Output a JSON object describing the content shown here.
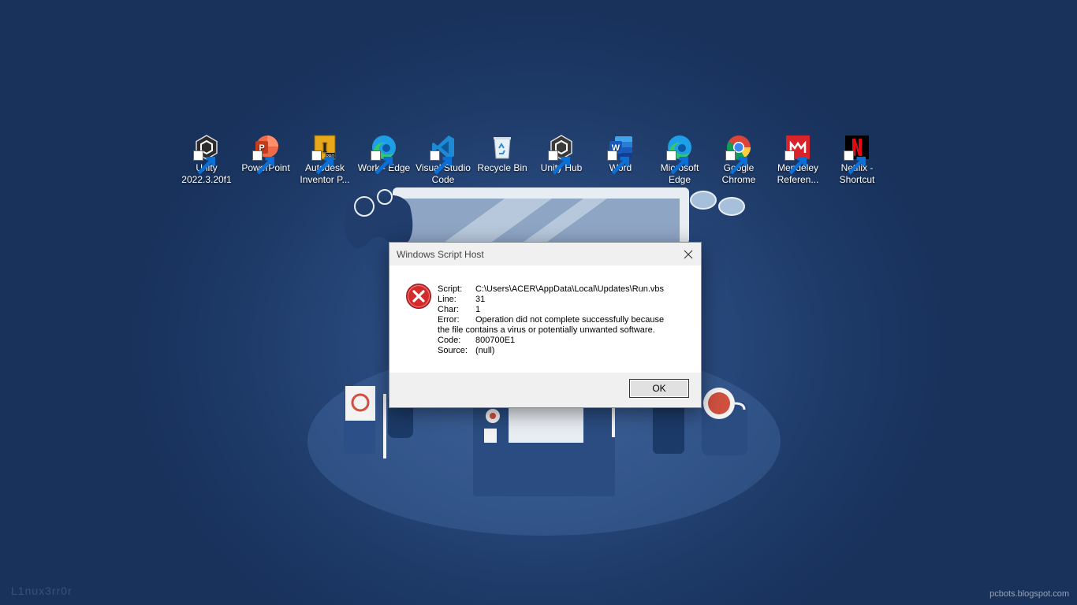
{
  "desktop": {
    "icons": [
      {
        "label": "Unity 2022.3.20f1",
        "icon": "unity-icon"
      },
      {
        "label": "PowerPoint",
        "icon": "powerpoint-icon"
      },
      {
        "label": "Autodesk Inventor P...",
        "icon": "autodesk-inventor-icon"
      },
      {
        "label": "Work - Edge",
        "icon": "edge-icon"
      },
      {
        "label": "Visual Studio Code",
        "icon": "vscode-icon"
      },
      {
        "label": "Recycle Bin",
        "icon": "recycle-bin-icon"
      },
      {
        "label": "Unity Hub",
        "icon": "unity-hub-icon"
      },
      {
        "label": "Word",
        "icon": "word-icon"
      },
      {
        "label": "Microsoft Edge",
        "icon": "edge-icon"
      },
      {
        "label": "Google Chrome",
        "icon": "chrome-icon"
      },
      {
        "label": "Mendeley Referen...",
        "icon": "mendeley-icon"
      },
      {
        "label": "Netflix - Shortcut",
        "icon": "netflix-icon"
      }
    ],
    "watermark_left": "L1nux3rr0r",
    "watermark_right": "pcbots.blogspot.com"
  },
  "dialog": {
    "title": "Windows Script Host",
    "fields": [
      {
        "key": "Script:",
        "value": "C:\\Users\\ACER\\AppData\\Local\\Updates\\Run.vbs"
      },
      {
        "key": "Line:",
        "value": "31"
      },
      {
        "key": "Char:",
        "value": "1"
      },
      {
        "key": "Error:",
        "value": "Operation did not complete successfully because"
      },
      {
        "key": "",
        "value": "the file contains a virus or potentially unwanted software."
      },
      {
        "key": "Code:",
        "value": "800700E1"
      },
      {
        "key": "Source:",
        "value": "(null)"
      }
    ],
    "ok_label": "OK",
    "icon": "error-icon"
  },
  "colors": {
    "desktop_bg": "#1d3966",
    "error_red": "#d32b2b",
    "dialog_footer": "#f0f0f0"
  }
}
